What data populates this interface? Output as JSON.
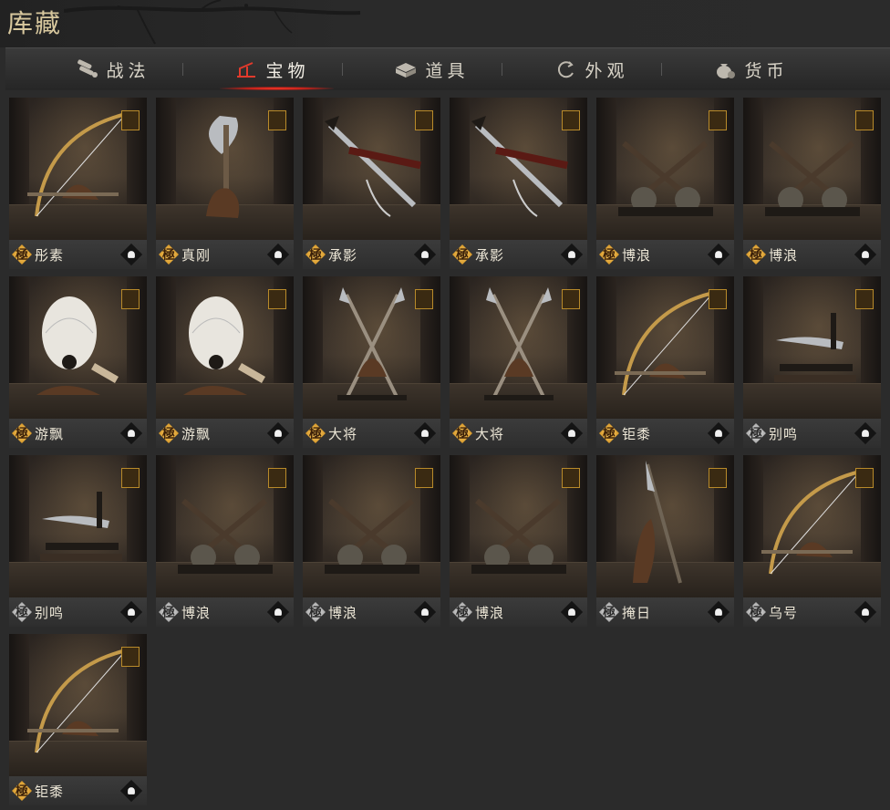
{
  "app_title": "库藏",
  "colors": {
    "accent": "#d0281c",
    "title": "#d8c89e",
    "gold_badge": "#d59628",
    "silver_badge": "#a8a8a8"
  },
  "tabs": [
    {
      "label": "战法",
      "icon": "scroll-icon",
      "active": false
    },
    {
      "label": "宝物",
      "icon": "treasure-stand-icon",
      "active": true
    },
    {
      "label": "道具",
      "icon": "box-icon",
      "active": false
    },
    {
      "label": "外观",
      "icon": "swirl-icon",
      "active": false
    },
    {
      "label": "货币",
      "icon": "money-bag-icon",
      "active": false
    }
  ],
  "items": [
    {
      "name": "彤素",
      "quality": "極",
      "tier": "gold",
      "type": "bow"
    },
    {
      "name": "真刚",
      "quality": "極",
      "tier": "gold",
      "type": "axe"
    },
    {
      "name": "承影",
      "quality": "極",
      "tier": "gold",
      "type": "sword"
    },
    {
      "name": "承影",
      "quality": "極",
      "tier": "gold",
      "type": "sword"
    },
    {
      "name": "博浪",
      "quality": "極",
      "tier": "gold",
      "type": "hammers"
    },
    {
      "name": "博浪",
      "quality": "極",
      "tier": "gold",
      "type": "hammers"
    },
    {
      "name": "游飘",
      "quality": "極",
      "tier": "gold",
      "type": "fan"
    },
    {
      "name": "游飘",
      "quality": "極",
      "tier": "gold",
      "type": "fan"
    },
    {
      "name": "大将",
      "quality": "極",
      "tier": "gold",
      "type": "spears"
    },
    {
      "name": "大将",
      "quality": "極",
      "tier": "gold",
      "type": "spears"
    },
    {
      "name": "钜黍",
      "quality": "極",
      "tier": "gold",
      "type": "bow"
    },
    {
      "name": "别鸣",
      "quality": "極",
      "tier": "silver",
      "type": "dagger"
    },
    {
      "name": "别鸣",
      "quality": "極",
      "tier": "silver",
      "type": "dagger"
    },
    {
      "name": "博浪",
      "quality": "極",
      "tier": "silver",
      "type": "hammers"
    },
    {
      "name": "博浪",
      "quality": "極",
      "tier": "silver",
      "type": "hammers"
    },
    {
      "name": "博浪",
      "quality": "極",
      "tier": "silver",
      "type": "hammers"
    },
    {
      "name": "掩日",
      "quality": "極",
      "tier": "silver",
      "type": "glaive"
    },
    {
      "name": "乌号",
      "quality": "極",
      "tier": "silver",
      "type": "bow"
    },
    {
      "name": "钜黍",
      "quality": "極",
      "tier": "gold",
      "type": "bow"
    }
  ]
}
